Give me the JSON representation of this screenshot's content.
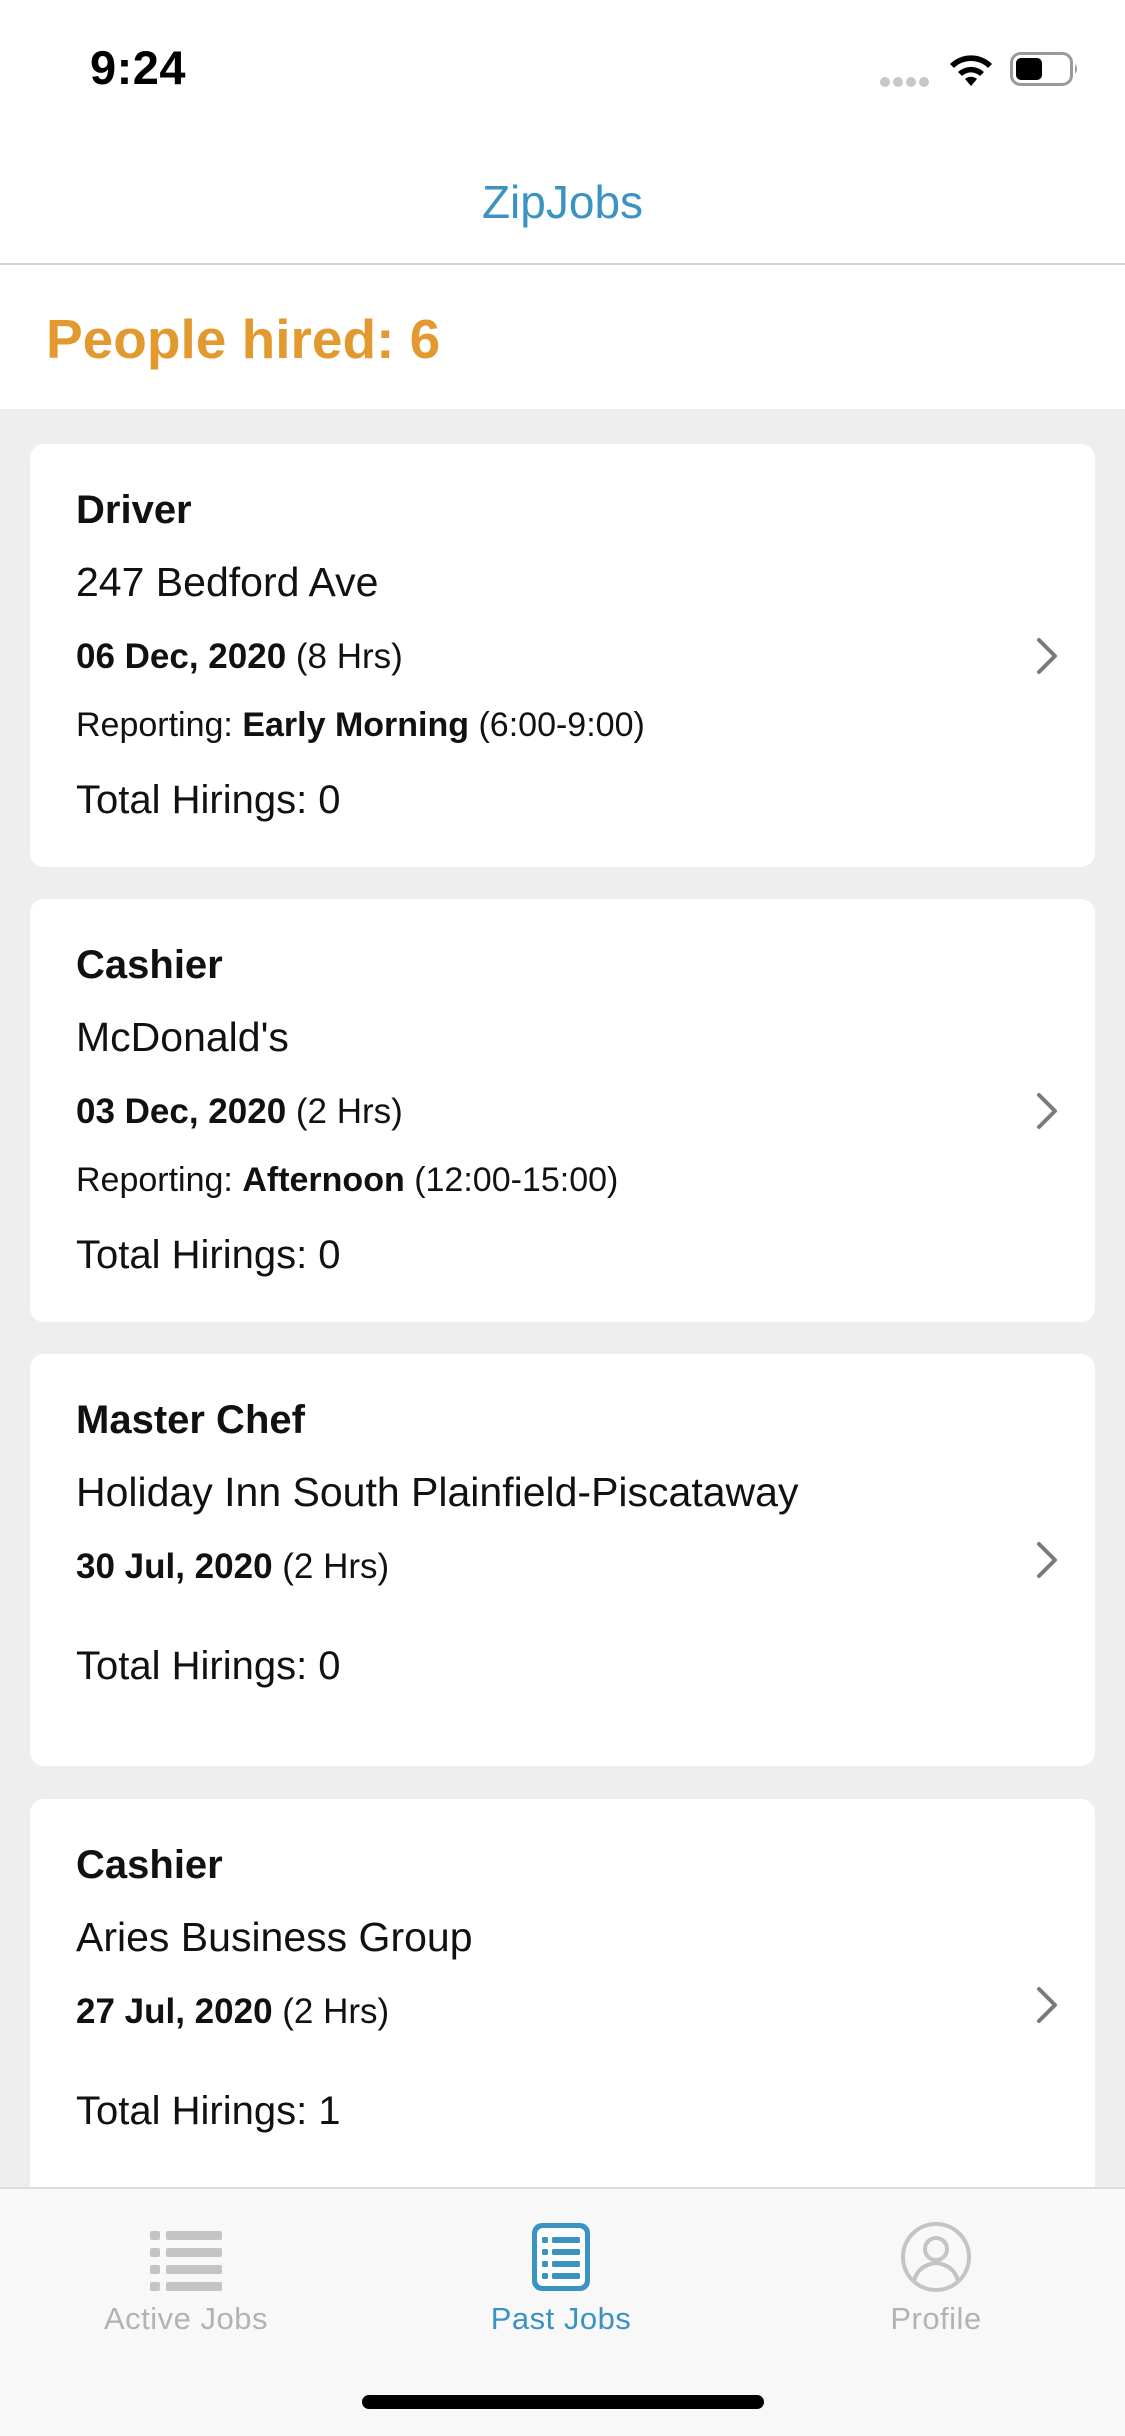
{
  "status_bar": {
    "time": "9:24"
  },
  "header": {
    "title": "ZipJobs"
  },
  "summary": {
    "people_hired_text": "People hired: 6"
  },
  "jobs": [
    {
      "title": "Driver",
      "place": "247 Bedford Ave",
      "date": "06 Dec, 2020",
      "duration": "(8 Hrs)",
      "reporting_label": "Reporting:",
      "reporting_slot": "Early Morning",
      "reporting_hours": "(6:00-9:00)",
      "total_hirings": "Total Hirings: 0"
    },
    {
      "title": "Cashier",
      "place": "McDonald's",
      "date": "03 Dec, 2020",
      "duration": "(2 Hrs)",
      "reporting_label": "Reporting:",
      "reporting_slot": "Afternoon",
      "reporting_hours": "(12:00-15:00)",
      "total_hirings": "Total Hirings: 0"
    },
    {
      "title": "Master Chef",
      "place": "Holiday Inn South Plainfield-Piscataway",
      "date": "30 Jul, 2020",
      "duration": "(2 Hrs)",
      "total_hirings": "Total Hirings: 0"
    },
    {
      "title": "Cashier",
      "place": "Aries Business Group",
      "date": "27 Jul, 2020",
      "duration": "(2 Hrs)",
      "total_hirings": "Total Hirings: 1"
    }
  ],
  "tab_bar": {
    "tabs": [
      {
        "label": "Active Jobs",
        "icon": "list-icon",
        "active": false
      },
      {
        "label": "Past Jobs",
        "icon": "list-box-icon",
        "active": true
      },
      {
        "label": "Profile",
        "icon": "profile-icon",
        "active": false
      }
    ]
  },
  "colors": {
    "accent": "#3a93c1",
    "hired": "#e29a30",
    "inactive": "#b3b3b3",
    "list_bg": "#eeeeee"
  }
}
